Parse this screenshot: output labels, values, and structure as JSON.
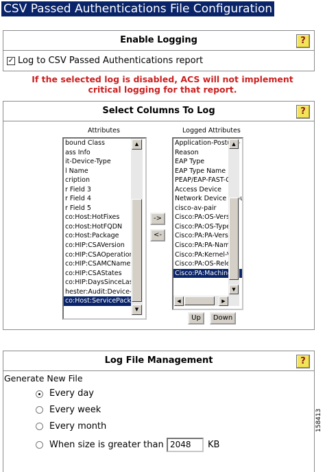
{
  "page": {
    "title": "CSV Passed Authentications File Configuration",
    "figure_number": "158413"
  },
  "enable_logging": {
    "header": "Enable Logging",
    "help_label": "?",
    "checkbox_checked": true,
    "checkbox_mark": "✓",
    "checkbox_label": "Log to CSV Passed Authentications report"
  },
  "warning": {
    "line1": "If the selected log is disabled, ACS will not implement",
    "line2": "critical logging for that report."
  },
  "select_columns": {
    "header": "Select Columns To Log",
    "help_label": "?",
    "attributes_label": "Attributes",
    "logged_label": "Logged Attributes",
    "attributes": [
      "bound Class",
      "ass Info",
      "it-Device-Type",
      "l Name",
      "cription",
      "r Field 3",
      "r Field 4",
      "r Field 5",
      "co:Host:HotFixes",
      "co:Host:HotFQDN",
      "co:Host:Package",
      "co:HIP:CSAVersion",
      "co:HIP:CSAOperation",
      "co:HIP:CSAMCName",
      "co:HIP:CSAStates",
      "co:HIP:DaysSinceLas",
      "hester:Audit:Device-T",
      "co:Host:ServicePacks"
    ],
    "attributes_selected_index": 17,
    "logged": [
      "Application-Posture-",
      "Reason",
      "EAP Type",
      "EAP Type Name",
      "PEAP/EAP-FAST-Cl",
      "Access Device",
      "Network Device Grou",
      "cisco-av-pair",
      "Cisco:PA:OS-Version",
      "Cisco:PA:OS-Type",
      "Cisco:PA:PA-Version",
      "Cisco:PA:PA-Name",
      "Cisco:PA:Kernel-Ver",
      "Cisco:PA:OS-Releas",
      "Cisco:PA:Machine-P"
    ],
    "logged_selected_index": 14,
    "add_button": "->",
    "remove_button": "<-",
    "up_button": "Up",
    "down_button": "Down"
  },
  "log_file_management": {
    "header": "Log File Management",
    "help_label": "?",
    "generate_label": "Generate New File",
    "options": [
      {
        "label": "Every day",
        "selected": true
      },
      {
        "label": "Every week",
        "selected": false
      },
      {
        "label": "Every month",
        "selected": false
      },
      {
        "label": "When size is greater than",
        "selected": false
      }
    ],
    "size_value": "2048",
    "size_unit": "KB"
  }
}
